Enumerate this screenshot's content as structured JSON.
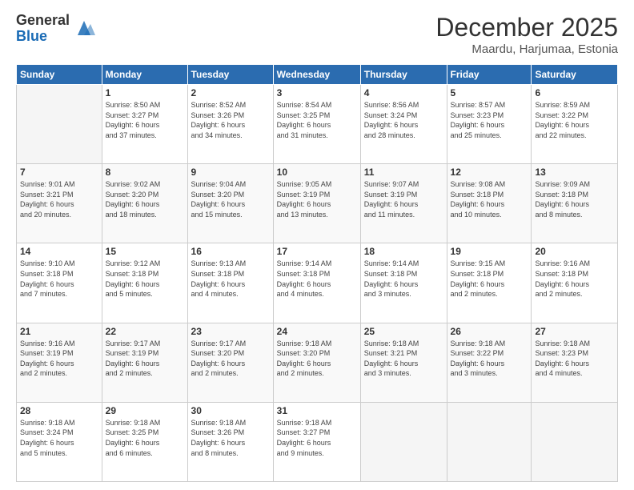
{
  "logo": {
    "general": "General",
    "blue": "Blue"
  },
  "header": {
    "month": "December 2025",
    "location": "Maardu, Harjumaa, Estonia"
  },
  "weekdays": [
    "Sunday",
    "Monday",
    "Tuesday",
    "Wednesday",
    "Thursday",
    "Friday",
    "Saturday"
  ],
  "weeks": [
    [
      {
        "day": "",
        "info": ""
      },
      {
        "day": "1",
        "info": "Sunrise: 8:50 AM\nSunset: 3:27 PM\nDaylight: 6 hours\nand 37 minutes."
      },
      {
        "day": "2",
        "info": "Sunrise: 8:52 AM\nSunset: 3:26 PM\nDaylight: 6 hours\nand 34 minutes."
      },
      {
        "day": "3",
        "info": "Sunrise: 8:54 AM\nSunset: 3:25 PM\nDaylight: 6 hours\nand 31 minutes."
      },
      {
        "day": "4",
        "info": "Sunrise: 8:56 AM\nSunset: 3:24 PM\nDaylight: 6 hours\nand 28 minutes."
      },
      {
        "day": "5",
        "info": "Sunrise: 8:57 AM\nSunset: 3:23 PM\nDaylight: 6 hours\nand 25 minutes."
      },
      {
        "day": "6",
        "info": "Sunrise: 8:59 AM\nSunset: 3:22 PM\nDaylight: 6 hours\nand 22 minutes."
      }
    ],
    [
      {
        "day": "7",
        "info": "Sunrise: 9:01 AM\nSunset: 3:21 PM\nDaylight: 6 hours\nand 20 minutes."
      },
      {
        "day": "8",
        "info": "Sunrise: 9:02 AM\nSunset: 3:20 PM\nDaylight: 6 hours\nand 18 minutes."
      },
      {
        "day": "9",
        "info": "Sunrise: 9:04 AM\nSunset: 3:20 PM\nDaylight: 6 hours\nand 15 minutes."
      },
      {
        "day": "10",
        "info": "Sunrise: 9:05 AM\nSunset: 3:19 PM\nDaylight: 6 hours\nand 13 minutes."
      },
      {
        "day": "11",
        "info": "Sunrise: 9:07 AM\nSunset: 3:19 PM\nDaylight: 6 hours\nand 11 minutes."
      },
      {
        "day": "12",
        "info": "Sunrise: 9:08 AM\nSunset: 3:18 PM\nDaylight: 6 hours\nand 10 minutes."
      },
      {
        "day": "13",
        "info": "Sunrise: 9:09 AM\nSunset: 3:18 PM\nDaylight: 6 hours\nand 8 minutes."
      }
    ],
    [
      {
        "day": "14",
        "info": "Sunrise: 9:10 AM\nSunset: 3:18 PM\nDaylight: 6 hours\nand 7 minutes."
      },
      {
        "day": "15",
        "info": "Sunrise: 9:12 AM\nSunset: 3:18 PM\nDaylight: 6 hours\nand 5 minutes."
      },
      {
        "day": "16",
        "info": "Sunrise: 9:13 AM\nSunset: 3:18 PM\nDaylight: 6 hours\nand 4 minutes."
      },
      {
        "day": "17",
        "info": "Sunrise: 9:14 AM\nSunset: 3:18 PM\nDaylight: 6 hours\nand 4 minutes."
      },
      {
        "day": "18",
        "info": "Sunrise: 9:14 AM\nSunset: 3:18 PM\nDaylight: 6 hours\nand 3 minutes."
      },
      {
        "day": "19",
        "info": "Sunrise: 9:15 AM\nSunset: 3:18 PM\nDaylight: 6 hours\nand 2 minutes."
      },
      {
        "day": "20",
        "info": "Sunrise: 9:16 AM\nSunset: 3:18 PM\nDaylight: 6 hours\nand 2 minutes."
      }
    ],
    [
      {
        "day": "21",
        "info": "Sunrise: 9:16 AM\nSunset: 3:19 PM\nDaylight: 6 hours\nand 2 minutes."
      },
      {
        "day": "22",
        "info": "Sunrise: 9:17 AM\nSunset: 3:19 PM\nDaylight: 6 hours\nand 2 minutes."
      },
      {
        "day": "23",
        "info": "Sunrise: 9:17 AM\nSunset: 3:20 PM\nDaylight: 6 hours\nand 2 minutes."
      },
      {
        "day": "24",
        "info": "Sunrise: 9:18 AM\nSunset: 3:20 PM\nDaylight: 6 hours\nand 2 minutes."
      },
      {
        "day": "25",
        "info": "Sunrise: 9:18 AM\nSunset: 3:21 PM\nDaylight: 6 hours\nand 3 minutes."
      },
      {
        "day": "26",
        "info": "Sunrise: 9:18 AM\nSunset: 3:22 PM\nDaylight: 6 hours\nand 3 minutes."
      },
      {
        "day": "27",
        "info": "Sunrise: 9:18 AM\nSunset: 3:23 PM\nDaylight: 6 hours\nand 4 minutes."
      }
    ],
    [
      {
        "day": "28",
        "info": "Sunrise: 9:18 AM\nSunset: 3:24 PM\nDaylight: 6 hours\nand 5 minutes."
      },
      {
        "day": "29",
        "info": "Sunrise: 9:18 AM\nSunset: 3:25 PM\nDaylight: 6 hours\nand 6 minutes."
      },
      {
        "day": "30",
        "info": "Sunrise: 9:18 AM\nSunset: 3:26 PM\nDaylight: 6 hours\nand 8 minutes."
      },
      {
        "day": "31",
        "info": "Sunrise: 9:18 AM\nSunset: 3:27 PM\nDaylight: 6 hours\nand 9 minutes."
      },
      {
        "day": "",
        "info": ""
      },
      {
        "day": "",
        "info": ""
      },
      {
        "day": "",
        "info": ""
      }
    ]
  ]
}
